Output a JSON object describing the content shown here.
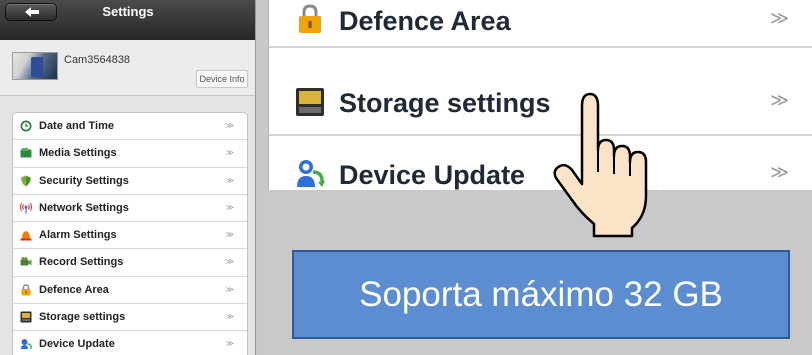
{
  "header": {
    "back_icon": "back-arrow-icon",
    "title": "Settings"
  },
  "device": {
    "name": "Cam3564838",
    "info_label": "Device Info"
  },
  "menu": {
    "items": [
      {
        "label": "Date and Time",
        "icon": "clock-icon",
        "chevron": "≫"
      },
      {
        "label": "Media Settings",
        "icon": "media-folder-icon",
        "chevron": "≫"
      },
      {
        "label": "Security Settings",
        "icon": "shield-icon",
        "chevron": "≫"
      },
      {
        "label": "Network Settings",
        "icon": "wifi-antenna-icon",
        "chevron": "≫"
      },
      {
        "label": "Alarm Settings",
        "icon": "alarm-bell-icon",
        "chevron": "≫"
      },
      {
        "label": "Record Settings",
        "icon": "video-camera-icon",
        "chevron": "≫"
      },
      {
        "label": "Defence Area",
        "icon": "padlock-icon",
        "chevron": "≫"
      },
      {
        "label": "Storage settings",
        "icon": "sd-card-icon",
        "chevron": "≫"
      },
      {
        "label": "Device Update",
        "icon": "update-arrows-icon",
        "chevron": "≫"
      }
    ]
  },
  "zoom": {
    "items": [
      {
        "label": "Defence Area",
        "icon": "padlock-icon",
        "chevron": "≫"
      },
      {
        "label": "Storage settings",
        "icon": "sd-card-icon",
        "chevron": "≫"
      },
      {
        "label": "Device Update",
        "icon": "update-arrows-icon",
        "chevron": "≫"
      }
    ]
  },
  "pointer": {
    "icon": "pointing-hand-icon"
  },
  "callout": {
    "text": "Soporta máximo 32 GB"
  },
  "colors": {
    "header_bg": "#333333",
    "callout_bg": "#5b8dd0",
    "callout_border": "#2f5a99",
    "panel_bg": "#e4e4e4"
  }
}
